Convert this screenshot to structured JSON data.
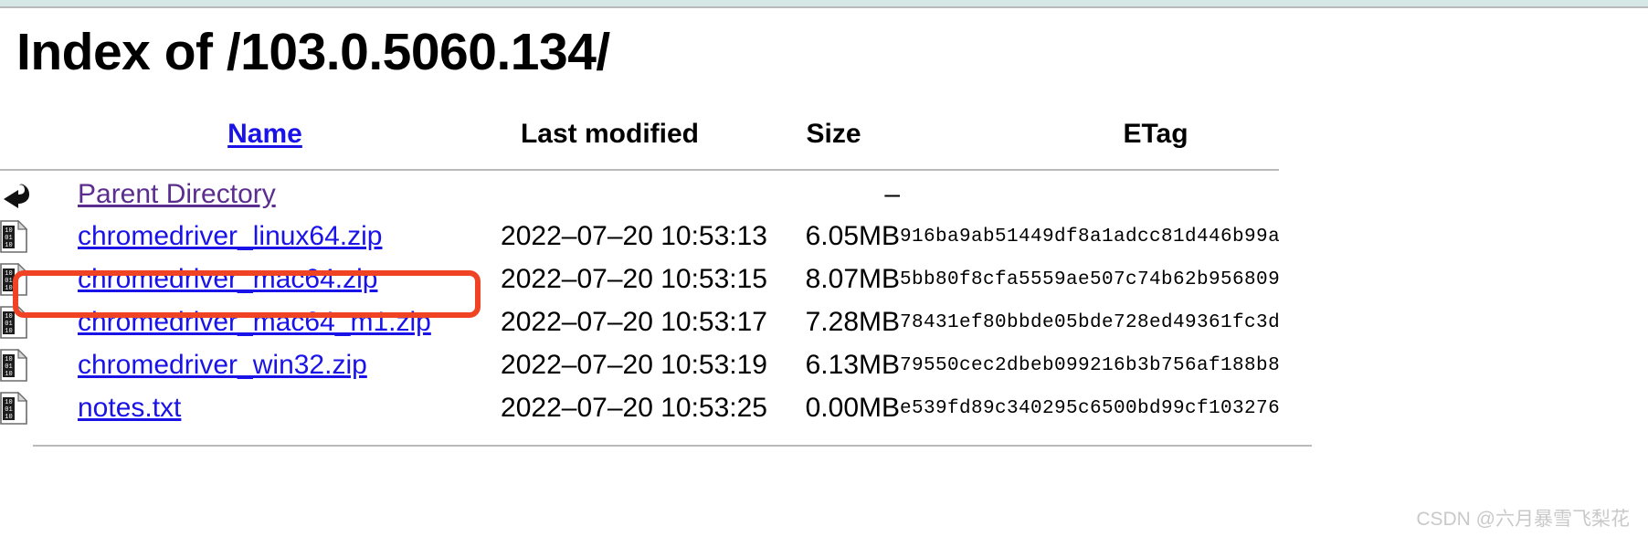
{
  "page": {
    "title": "Index of /103.0.5060.134/"
  },
  "table": {
    "headers": {
      "icon": "",
      "name": "Name",
      "last_modified": "Last modified",
      "size": "Size",
      "etag": "ETag"
    },
    "rows": [
      {
        "icon": "back-arrow-icon",
        "name": "Parent Directory",
        "last_modified": "",
        "size": "–",
        "etag": ""
      },
      {
        "icon": "binary-file-icon",
        "name": "chromedriver_linux64.zip",
        "last_modified": "2022–07–20 10:53:13",
        "size": "6.05MB",
        "etag": "916ba9ab51449df8a1adcc81d446b99a"
      },
      {
        "icon": "binary-file-icon",
        "name": "chromedriver_mac64.zip",
        "last_modified": "2022–07–20 10:53:15",
        "size": "8.07MB",
        "etag": "5bb80f8cfa5559ae507c74b62b956809"
      },
      {
        "icon": "binary-file-icon",
        "name": "chromedriver_mac64_m1.zip",
        "last_modified": "2022–07–20 10:53:17",
        "size": "7.28MB",
        "etag": "78431ef80bbde05bde728ed49361fc3d"
      },
      {
        "icon": "binary-file-icon",
        "name": "chromedriver_win32.zip",
        "last_modified": "2022–07–20 10:53:19",
        "size": "6.13MB",
        "etag": "79550cec2dbeb099216b3b756af188b8"
      },
      {
        "icon": "binary-file-icon",
        "name": "notes.txt",
        "last_modified": "2022–07–20 10:53:25",
        "size": "0.00MB",
        "etag": "e539fd89c340295c6500bd99cf103276"
      }
    ]
  },
  "annotation": {
    "highlight_target": "chromedriver_mac64.zip",
    "highlight_color": "#ef4323"
  },
  "watermark": {
    "text": "CSDN @六月暴雪飞梨花"
  },
  "colors": {
    "link": "#1a13e8",
    "link_visited": "#5a2d8e",
    "rule": "#b9b9b9",
    "top_band": "#d6e8e6"
  }
}
